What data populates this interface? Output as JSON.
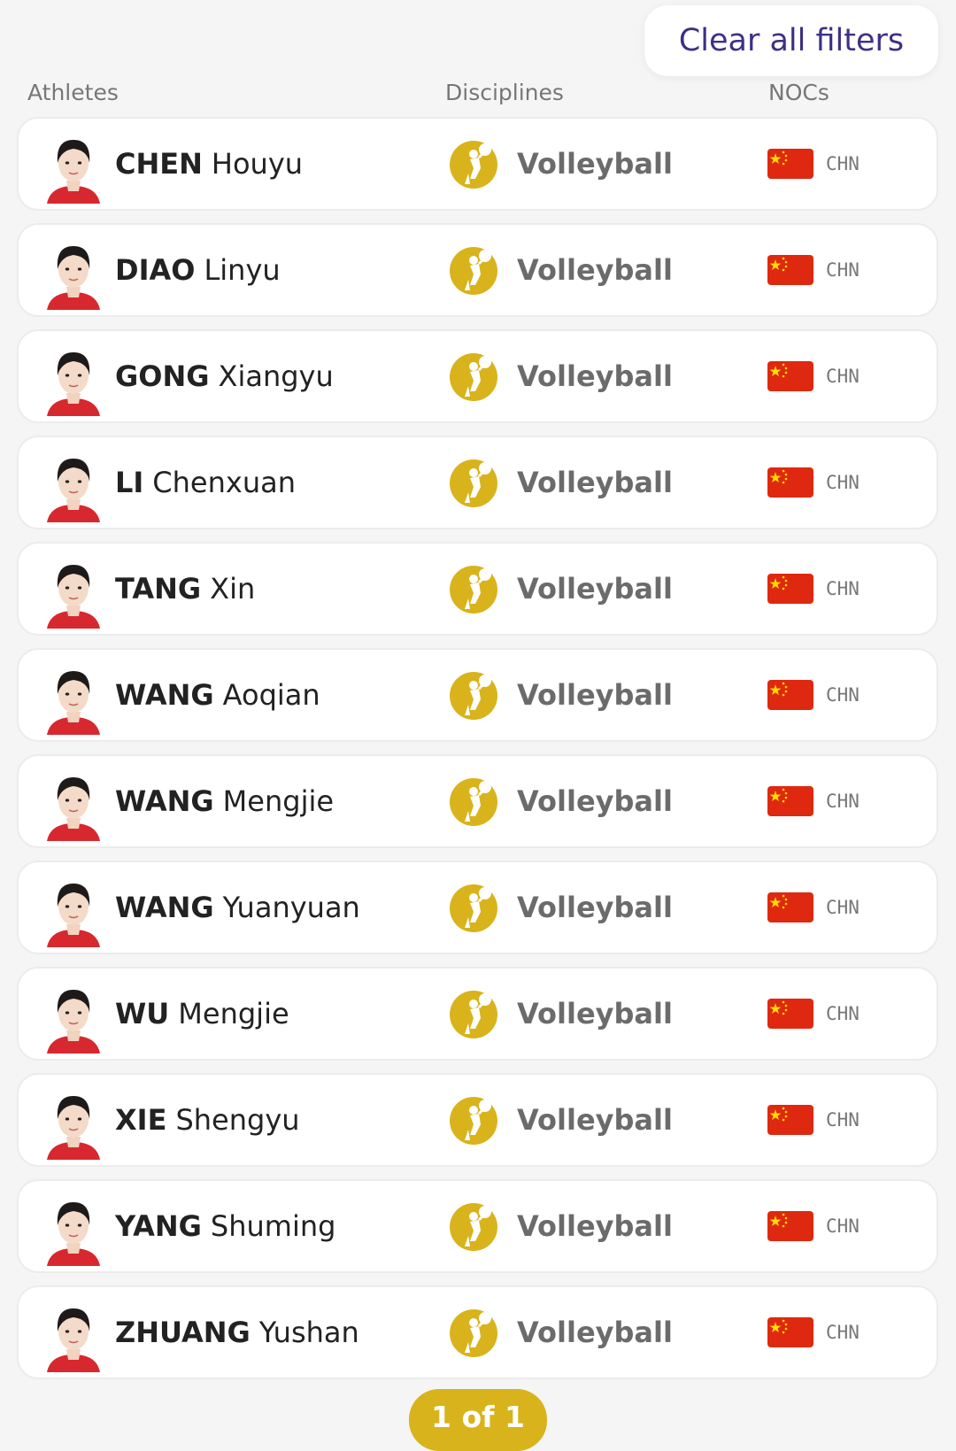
{
  "filters": {
    "clear_label": "Clear all filters"
  },
  "columns": {
    "athletes": "Athletes",
    "disciplines": "Disciplines",
    "nocs": "NOCs"
  },
  "athletes": [
    {
      "last": "CHEN",
      "first": "Houyu",
      "discipline": "Volleyball",
      "noc": "CHN"
    },
    {
      "last": "DIAO",
      "first": "Linyu",
      "discipline": "Volleyball",
      "noc": "CHN"
    },
    {
      "last": "GONG",
      "first": "Xiangyu",
      "discipline": "Volleyball",
      "noc": "CHN"
    },
    {
      "last": "LI",
      "first": "Chenxuan",
      "discipline": "Volleyball",
      "noc": "CHN"
    },
    {
      "last": "TANG",
      "first": "Xin",
      "discipline": "Volleyball",
      "noc": "CHN"
    },
    {
      "last": "WANG",
      "first": "Aoqian",
      "discipline": "Volleyball",
      "noc": "CHN"
    },
    {
      "last": "WANG",
      "first": "Mengjie",
      "discipline": "Volleyball",
      "noc": "CHN"
    },
    {
      "last": "WANG",
      "first": "Yuanyuan",
      "discipline": "Volleyball",
      "noc": "CHN"
    },
    {
      "last": "WU",
      "first": "Mengjie",
      "discipline": "Volleyball",
      "noc": "CHN"
    },
    {
      "last": "XIE",
      "first": "Shengyu",
      "discipline": "Volleyball",
      "noc": "CHN"
    },
    {
      "last": "YANG",
      "first": "Shuming",
      "discipline": "Volleyball",
      "noc": "CHN"
    },
    {
      "last": "ZHUANG",
      "first": "Yushan",
      "discipline": "Volleyball",
      "noc": "CHN"
    }
  ],
  "icons": {
    "discipline": "volleyball-pictogram-icon",
    "flag": "china-flag-icon",
    "avatar": "athlete-photo"
  },
  "colors": {
    "accent_gold": "#d8b31c",
    "link_purple": "#3f2f86",
    "flag_red": "#de2910",
    "flag_star": "#ffde00"
  },
  "pagination": {
    "label": "1 of 1"
  }
}
